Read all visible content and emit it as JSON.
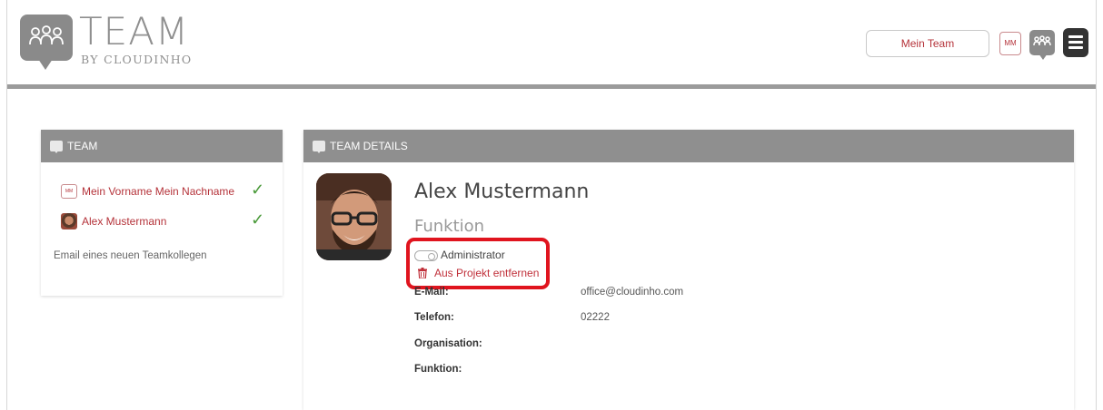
{
  "header": {
    "logo_title": "TEAM",
    "logo_subtitle": "BY CLOUDINHO",
    "team_button": "Mein Team",
    "user_initials": "MM",
    "icons": [
      "team-logo-icon",
      "team-icon",
      "hamburger-menu-icon"
    ]
  },
  "team_panel": {
    "title": "TEAM",
    "members": [
      {
        "name": "Mein Vorname Mein Nachname",
        "badge": "MM",
        "confirmed": true
      },
      {
        "name": "Alex Mustermann",
        "confirmed": true
      }
    ],
    "invite_placeholder": "Email eines neuen Teamkollegen"
  },
  "details_panel": {
    "title": "TEAM DETAILS",
    "name": "Alex Mustermann",
    "function_heading": "Funktion",
    "admin_label": "Administrator",
    "admin_enabled": false,
    "remove_label": "Aus Projekt entfernen",
    "fields": [
      {
        "label": "E-Mail:",
        "value": "office@cloudinho.com"
      },
      {
        "label": "Telefon:",
        "value": "02222"
      },
      {
        "label": "Organisation:",
        "value": ""
      },
      {
        "label": "Funktion:",
        "value": ""
      }
    ]
  },
  "colors": {
    "accent_red": "#b5333a",
    "highlight_red": "#e0141e",
    "panel_header": "#8f8f8f",
    "check_green": "#4a9a3a"
  }
}
